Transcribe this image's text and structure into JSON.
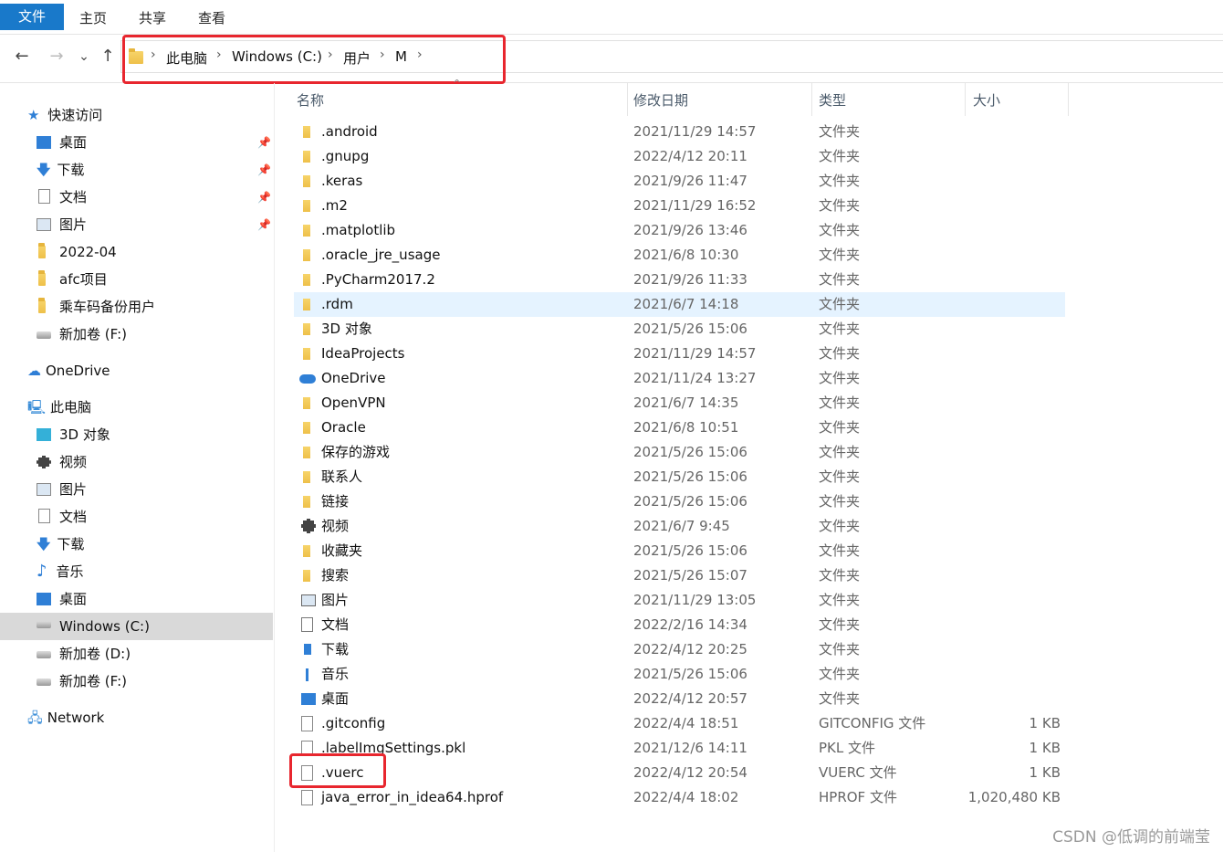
{
  "ribbon": {
    "tabs": [
      "文件",
      "主页",
      "共享",
      "查看"
    ]
  },
  "nav": {
    "back": "←",
    "forward": "→",
    "recent": "⌄",
    "up": "↑",
    "breadcrumb": [
      "此电脑",
      "Windows (C:)",
      "用户",
      "M"
    ]
  },
  "sidebar": {
    "quick_access": "快速访问",
    "quick_items": [
      "桌面",
      "下载",
      "文档",
      "图片",
      "2022-04",
      "afc项目",
      "乘车码备份用户",
      "新加卷 (F:)"
    ],
    "onedrive": "OneDrive",
    "this_pc": "此电脑",
    "pc_items": [
      "3D 对象",
      "视频",
      "图片",
      "文档",
      "下载",
      "音乐",
      "桌面",
      "Windows (C:)",
      "新加卷 (D:)",
      "新加卷 (F:)"
    ],
    "network": "Network"
  },
  "columns": [
    "名称",
    "修改日期",
    "类型",
    "大小"
  ],
  "files": [
    {
      "name": ".android",
      "date": "2021/11/29 14:57",
      "type": "文件夹",
      "size": "",
      "icon": "folder-icon"
    },
    {
      "name": ".gnupg",
      "date": "2022/4/12 20:11",
      "type": "文件夹",
      "size": "",
      "icon": "folder-icon"
    },
    {
      "name": ".keras",
      "date": "2021/9/26 11:47",
      "type": "文件夹",
      "size": "",
      "icon": "folder-icon"
    },
    {
      "name": ".m2",
      "date": "2021/11/29 16:52",
      "type": "文件夹",
      "size": "",
      "icon": "folder-icon"
    },
    {
      "name": ".matplotlib",
      "date": "2021/9/26 13:46",
      "type": "文件夹",
      "size": "",
      "icon": "folder-icon"
    },
    {
      "name": ".oracle_jre_usage",
      "date": "2021/6/8 10:30",
      "type": "文件夹",
      "size": "",
      "icon": "folder-icon"
    },
    {
      "name": ".PyCharm2017.2",
      "date": "2021/9/26 11:33",
      "type": "文件夹",
      "size": "",
      "icon": "folder-icon"
    },
    {
      "name": ".rdm",
      "date": "2021/6/7 14:18",
      "type": "文件夹",
      "size": "",
      "icon": "folder-icon"
    },
    {
      "name": "3D 对象",
      "date": "2021/5/26 15:06",
      "type": "文件夹",
      "size": "",
      "icon": "folder-icon"
    },
    {
      "name": "IdeaProjects",
      "date": "2021/11/29 14:57",
      "type": "文件夹",
      "size": "",
      "icon": "folder-icon"
    },
    {
      "name": "OneDrive",
      "date": "2021/11/24 13:27",
      "type": "文件夹",
      "size": "",
      "icon": "cloud-icon"
    },
    {
      "name": "OpenVPN",
      "date": "2021/6/7 14:35",
      "type": "文件夹",
      "size": "",
      "icon": "folder-icon"
    },
    {
      "name": "Oracle",
      "date": "2021/6/8 10:51",
      "type": "文件夹",
      "size": "",
      "icon": "folder-icon"
    },
    {
      "name": "保存的游戏",
      "date": "2021/5/26 15:06",
      "type": "文件夹",
      "size": "",
      "icon": "folder-icon"
    },
    {
      "name": "联系人",
      "date": "2021/5/26 15:06",
      "type": "文件夹",
      "size": "",
      "icon": "folder-icon"
    },
    {
      "name": "链接",
      "date": "2021/5/26 15:06",
      "type": "文件夹",
      "size": "",
      "icon": "folder-icon"
    },
    {
      "name": "视频",
      "date": "2021/6/7 9:45",
      "type": "文件夹",
      "size": "",
      "icon": "video-icon"
    },
    {
      "name": "收藏夹",
      "date": "2021/5/26 15:06",
      "type": "文件夹",
      "size": "",
      "icon": "folder-icon"
    },
    {
      "name": "搜索",
      "date": "2021/5/26 15:07",
      "type": "文件夹",
      "size": "",
      "icon": "folder-icon"
    },
    {
      "name": "图片",
      "date": "2021/11/29 13:05",
      "type": "文件夹",
      "size": "",
      "icon": "picture-icon"
    },
    {
      "name": "文档",
      "date": "2022/2/16 14:34",
      "type": "文件夹",
      "size": "",
      "icon": "document-icon"
    },
    {
      "name": "下载",
      "date": "2022/4/12 20:25",
      "type": "文件夹",
      "size": "",
      "icon": "download-icon"
    },
    {
      "name": "音乐",
      "date": "2021/5/26 15:06",
      "type": "文件夹",
      "size": "",
      "icon": "music-icon"
    },
    {
      "name": "桌面",
      "date": "2022/4/12 20:57",
      "type": "文件夹",
      "size": "",
      "icon": "desktop-icon"
    },
    {
      "name": ".gitconfig",
      "date": "2022/4/4 18:51",
      "type": "GITCONFIG 文件",
      "size": "1 KB",
      "icon": "file-icon"
    },
    {
      "name": ".labelImgSettings.pkl",
      "date": "2021/12/6 14:11",
      "type": "PKL 文件",
      "size": "1 KB",
      "icon": "file-icon"
    },
    {
      "name": ".vuerc",
      "date": "2022/4/12 20:54",
      "type": "VUERC 文件",
      "size": "1 KB",
      "icon": "file-icon"
    },
    {
      "name": "java_error_in_idea64.hprof",
      "date": "2022/4/4 18:02",
      "type": "HPROF 文件",
      "size": "1,020,480 KB",
      "icon": "file-icon"
    }
  ],
  "watermark": "CSDN @低调的前端莹",
  "colors": {
    "accent": "#1979ca",
    "highlight_box": "#e8262e",
    "row_hover": "#e5f3ff",
    "selected": "#d9d9d9"
  }
}
